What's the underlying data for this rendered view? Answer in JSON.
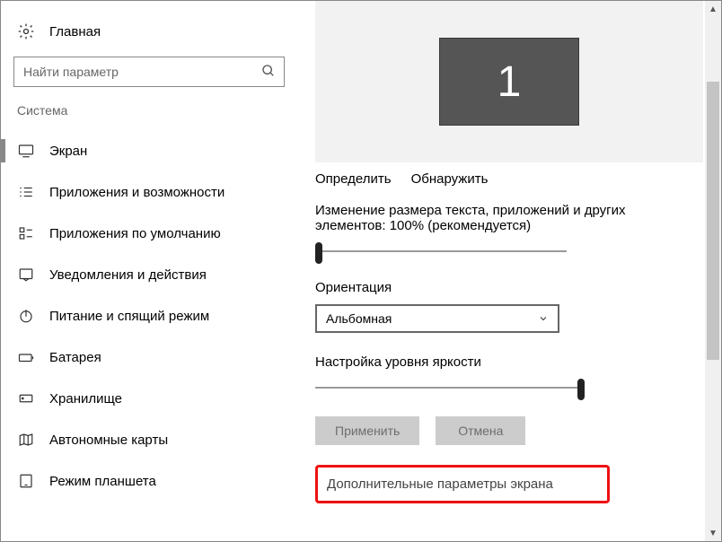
{
  "sidebar": {
    "home": "Главная",
    "search_placeholder": "Найти параметр",
    "category": "Система",
    "items": [
      {
        "label": "Экран"
      },
      {
        "label": "Приложения и возможности"
      },
      {
        "label": "Приложения по умолчанию"
      },
      {
        "label": "Уведомления и действия"
      },
      {
        "label": "Питание и спящий режим"
      },
      {
        "label": "Батарея"
      },
      {
        "label": "Хранилище"
      },
      {
        "label": "Автономные карты"
      },
      {
        "label": "Режим планшета"
      }
    ]
  },
  "main": {
    "display_number": "1",
    "detect": "Определить",
    "identify": "Обнаружить",
    "scale_label": "Изменение размера текста, приложений и других элементов: 100% (рекомендуется)",
    "orientation_label": "Ориентация",
    "orientation_value": "Альбомная",
    "brightness_label": "Настройка уровня яркости",
    "apply": "Применить",
    "cancel": "Отмена",
    "advanced": "Дополнительные параметры экрана"
  }
}
